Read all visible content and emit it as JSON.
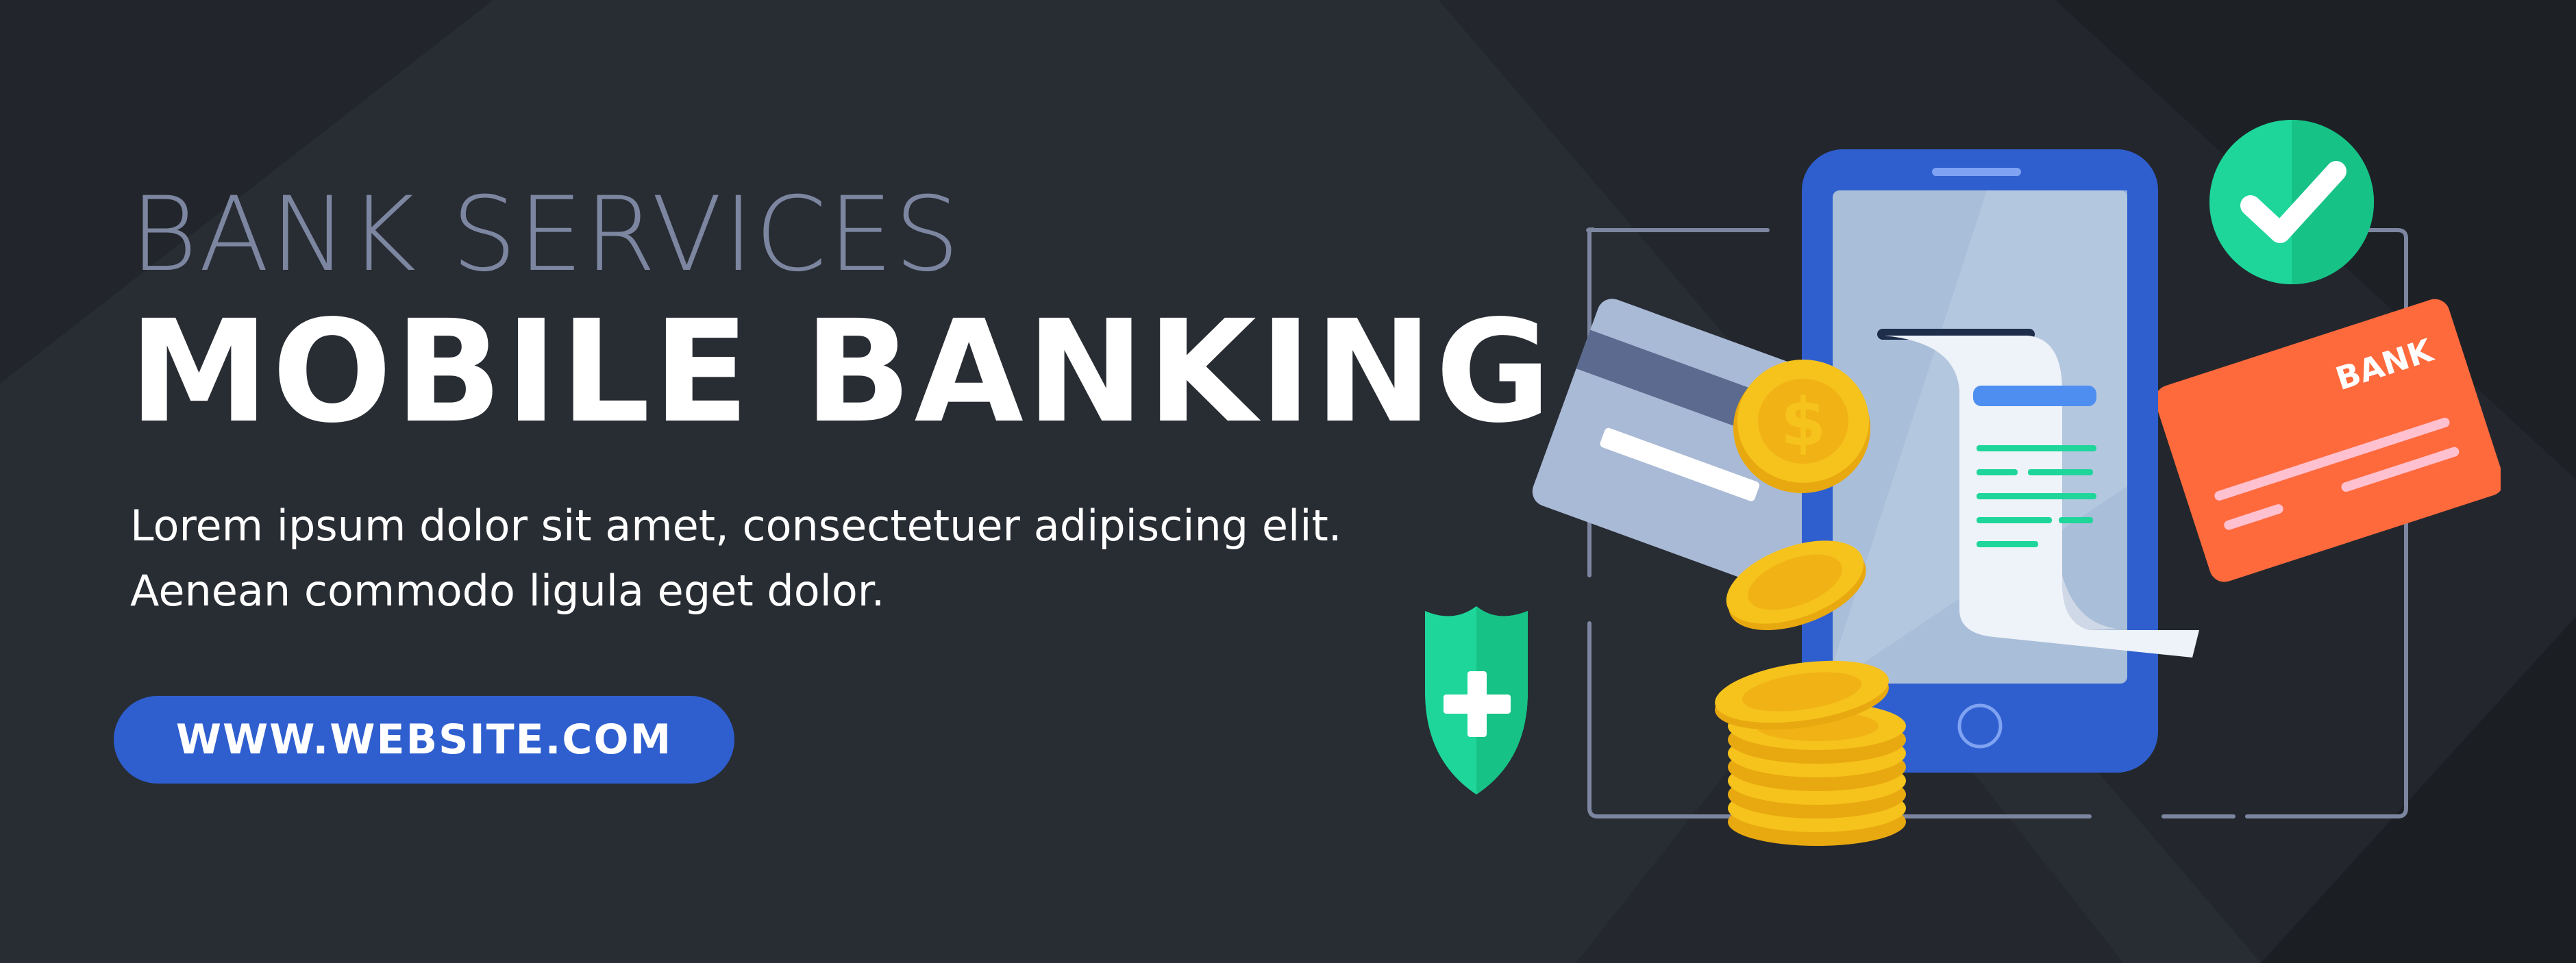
{
  "banner": {
    "kicker": "BANK SERVICES",
    "headline": "MOBILE BANKING",
    "description": [
      "Lorem ipsum dolor sit amet, consectetuer adipiscing elit.",
      "Aenean commodo ligula eget dolor."
    ],
    "cta_label": "WWW.WEBSITE.COM"
  },
  "illustration": {
    "card_label": "BANK",
    "coin_symbol": "$",
    "icons": [
      "phone-icon",
      "receipt-icon",
      "credit-card-icon",
      "coin-icon",
      "shield-plus-icon",
      "check-circle-icon"
    ]
  },
  "colors": {
    "background": "#282c33",
    "kicker": "#7d86a0",
    "cta": "#2f5fcf",
    "phone": "#2f5fcf",
    "accent_green": "#1ed69a",
    "card_orange": "#ff6a3d",
    "coin_gold": "#f6c21c"
  }
}
